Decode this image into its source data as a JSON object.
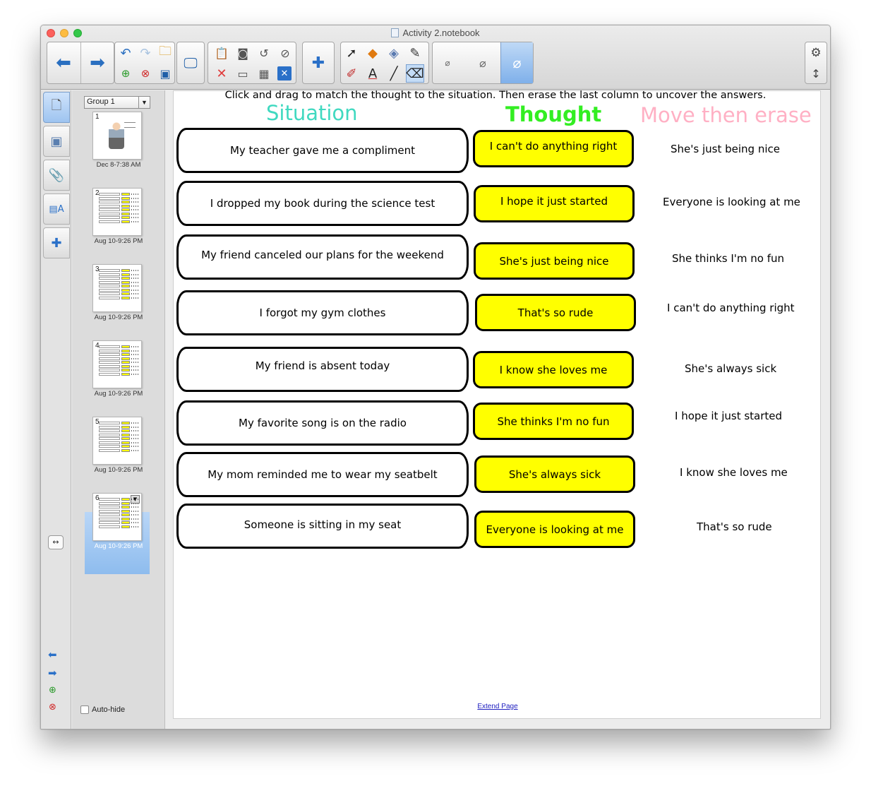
{
  "window": {
    "title": "Activity 2.notebook"
  },
  "sorter": {
    "group_label": "Group 1",
    "autohide_label": "Auto-hide",
    "thumbnails": [
      {
        "num": "1",
        "date": "Dec 8-7:38 AM"
      },
      {
        "num": "2",
        "date": "Aug 10-9:26 PM"
      },
      {
        "num": "3",
        "date": "Aug 10-9:26 PM"
      },
      {
        "num": "4",
        "date": "Aug 10-9:26 PM"
      },
      {
        "num": "5",
        "date": "Aug 10-9:26 PM"
      },
      {
        "num": "6",
        "date": "Aug 10-9:26 PM"
      }
    ]
  },
  "page": {
    "instruction": "Click and drag to match the thought to the situation. Then erase the last column to uncover the answers.",
    "headers": {
      "situation": "Situation",
      "thought": "Thought",
      "move": "Move then erase"
    },
    "header_colors": {
      "situation": "#40d9c0",
      "thought": "#33ee22",
      "move": "#ffb0c4"
    },
    "situations": [
      "My teacher gave me a compliment",
      "I dropped my book during the science test",
      "My friend canceled our plans for the weekend",
      "I forgot my gym clothes",
      "My friend is absent today",
      "My favorite song is on the radio",
      "My mom reminded me to wear my seatbelt",
      "Someone is sitting in my seat"
    ],
    "thoughts": [
      "I can't do anything right",
      "I hope it just started",
      "She's just being nice",
      "That's so rude",
      "I know she loves me",
      "She thinks I'm no fun",
      "She's always sick",
      "Everyone is looking at me"
    ],
    "answers": [
      "She's just being nice",
      "Everyone is looking at me",
      "She thinks I'm no fun",
      "I can't do anything right",
      "She's always sick",
      "I hope it just started",
      "I know she loves me",
      "That's so rude"
    ],
    "extend_link": "Extend Page"
  }
}
